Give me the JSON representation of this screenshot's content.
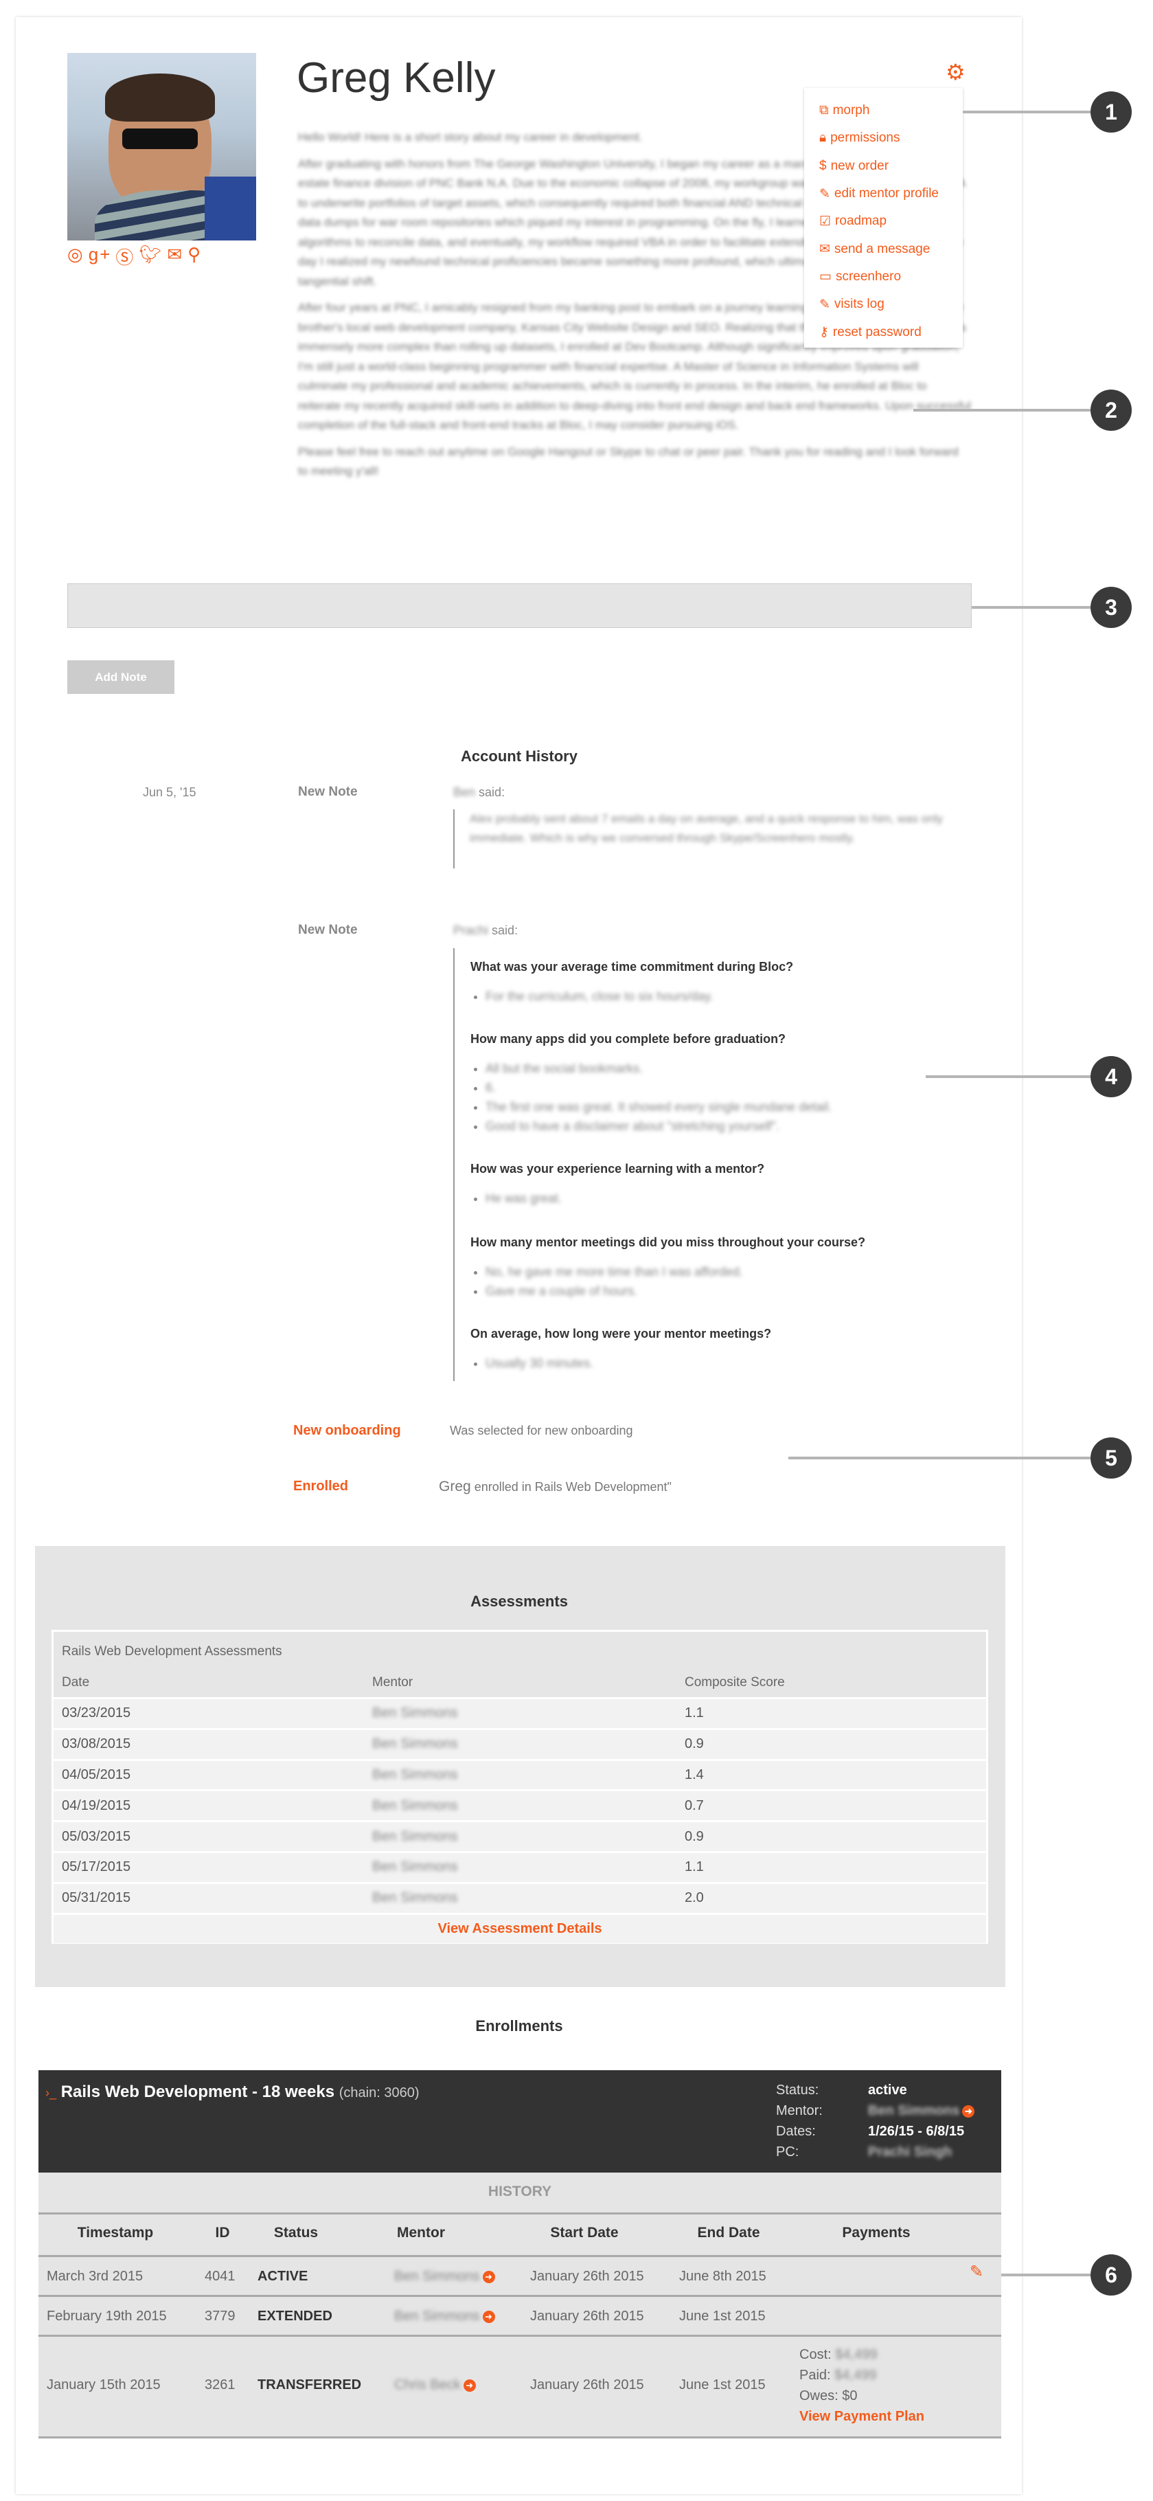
{
  "profile": {
    "name": "Greg Kelly",
    "social_icons": [
      "github-icon",
      "google-plus-icon",
      "skype-icon",
      "twitter-icon",
      "envelope-icon",
      "map-marker-icon"
    ],
    "bio": [
      "Hello World! Here is a short story about my career in development.",
      "After graduating with honors from The George Washington University, I began my career as a management intern for the real estate finance division of PNC Bank N.A. Due to the economic collapse of 2008, my workgroup was routinely summoned for M&A to underwrite portfolios of target assets, which consequently required both financial AND technical skills. As an intern, I managed data dumps for war room repositories which piqued my interest in programming. On the fly, I learned elementary construction of algorithms to reconcile data, and eventually, my workflow required VBA in order to facilitate extended logic as a capture tool. One day I realized my newfound technical proficiencies became something more profound, which ultimately forked my career on to a tangential shift.",
      "After four years at PNC, I amicably resigned from my banking post to embark on a journey learning how to code, beginning at my brother's local web development company, Kansas City Website Design and SEO. Realizing that the world of web development is immensely more complex than rolling up datasets, I enrolled at Dev Bootcamp. Although significantly improved upon graduation, I'm still just a world-class beginning programmer with financial expertise. A Master of Science in Information Systems will culminate my professional and academic achievements, which is currently in process. In the interim, he enrolled at Bloc to reiterate my recently acquired skill-sets in addition to deep-diving into front end design and back end frameworks. Upon successful completion of the full-stack and front-end tracks at Bloc, I may consider pursuing iOS.",
      "Please feel free to reach out anytime on Google Hangout or Skype to chat or peer pair. Thank you for reading and I look forward to meeting y'all!"
    ]
  },
  "menu": {
    "icon": "gear-icon",
    "items": [
      {
        "label": "morph",
        "icon": "external-link-icon",
        "glyph": "⧉"
      },
      {
        "label": "permissions",
        "icon": "lock-icon",
        "glyph": "🔒︎"
      },
      {
        "label": "new order",
        "icon": "dollar-icon",
        "glyph": "$"
      },
      {
        "label": "edit mentor profile",
        "icon": "edit-icon",
        "glyph": "✎"
      },
      {
        "label": "roadmap",
        "icon": "check-square-icon",
        "glyph": "☑"
      },
      {
        "label": "send a message",
        "icon": "envelope-icon",
        "glyph": "✉"
      },
      {
        "label": "screenhero",
        "icon": "desktop-icon",
        "glyph": "▭"
      },
      {
        "label": "visits log",
        "icon": "edit-icon",
        "glyph": "✎"
      },
      {
        "label": "reset password",
        "icon": "key-icon",
        "glyph": "⚷"
      }
    ]
  },
  "callouts": [
    "1",
    "2",
    "3",
    "4",
    "5",
    "6"
  ],
  "note": {
    "button": "Add Note"
  },
  "history": {
    "title": "Account History",
    "note1": {
      "date": "Jun 5, '15",
      "type": "New Note",
      "author": "Ben",
      "said": "said:",
      "text": "Alex probably sent about 7 emails a day on average, and a quick response to him, was only immediate. Which is why we conversed through Skype/Screenhero mostly."
    },
    "note2": {
      "type": "New Note",
      "author": "Prachi",
      "said": "said:",
      "qa": [
        {
          "q": "What was your average time commitment during Bloc?",
          "a": [
            "For the curriculum, close to six hours/day."
          ]
        },
        {
          "q": "How many apps did you complete before graduation?",
          "a": [
            "All but the social bookmarks.",
            "6.",
            "The first one was great. It showed every single mundane detail.",
            "Good to have a disclaimer about \"stretching yourself\"."
          ]
        },
        {
          "q": "How was your experience learning with a mentor?",
          "a": [
            "He was great."
          ]
        },
        {
          "q": "How many mentor meetings did you miss throughout your course?",
          "a": [
            "No, he gave me more time than I was afforded.",
            "Gave me a couple of hours."
          ]
        },
        {
          "q": "On average, how long were your mentor meetings?",
          "a": [
            "Usually 30 minutes."
          ]
        }
      ]
    },
    "onboarding": {
      "label": "New onboarding",
      "text": "Was selected for new onboarding"
    },
    "enrolled": {
      "label": "Enrolled",
      "name": "Greg",
      "text": "enrolled in Rails Web Development\""
    }
  },
  "assessments": {
    "title": "Assessments",
    "caption": "Rails Web Development Assessments",
    "headers": [
      "Date",
      "Mentor",
      "Composite Score"
    ],
    "rows": [
      [
        "03/23/2015",
        "Ben Simmons",
        "1.1"
      ],
      [
        "03/08/2015",
        "Ben Simmons",
        "0.9"
      ],
      [
        "04/05/2015",
        "Ben Simmons",
        "1.4"
      ],
      [
        "04/19/2015",
        "Ben Simmons",
        "0.7"
      ],
      [
        "05/03/2015",
        "Ben Simmons",
        "0.9"
      ],
      [
        "05/17/2015",
        "Ben Simmons",
        "1.1"
      ],
      [
        "05/31/2015",
        "Ben Simmons",
        "2.0"
      ]
    ],
    "link": "View Assessment Details"
  },
  "enrollments": {
    "title": "Enrollments",
    "course": "Rails Web Development - 18 weeks",
    "chain": "(chain: 3060)",
    "status_label": "Status:",
    "status": "active",
    "mentor_label": "Mentor:",
    "mentor": "Ben Simmons",
    "dates_label": "Dates:",
    "dates": "1/26/15 - 6/8/15",
    "pc_label": "PC:",
    "pc": "Prachi Singh",
    "history_label": "HISTORY",
    "headers": [
      "Timestamp",
      "ID",
      "Status",
      "Mentor",
      "Start Date",
      "End Date",
      "Payments"
    ],
    "rows": [
      [
        "March 3rd 2015",
        "4041",
        "ACTIVE",
        "Ben Simmons",
        "January 26th 2015",
        "June 8th 2015"
      ],
      [
        "February 19th 2015",
        "3779",
        "EXTENDED",
        "Ben Simmons",
        "January 26th 2015",
        "June 1st 2015"
      ],
      [
        "January 15th 2015",
        "3261",
        "TRANSFERRED",
        "Chris Beck",
        "January 26th 2015",
        "June 1st 2015"
      ]
    ],
    "payments": {
      "cost_label": "Cost:",
      "cost": "$4,499",
      "paid_label": "Paid:",
      "paid": "$4,499",
      "owes": "Owes: $0",
      "link": "View Payment Plan"
    }
  },
  "colors": {
    "accent": "#f35b1c",
    "dark": "#333333",
    "panel": "#e5e5e5"
  }
}
